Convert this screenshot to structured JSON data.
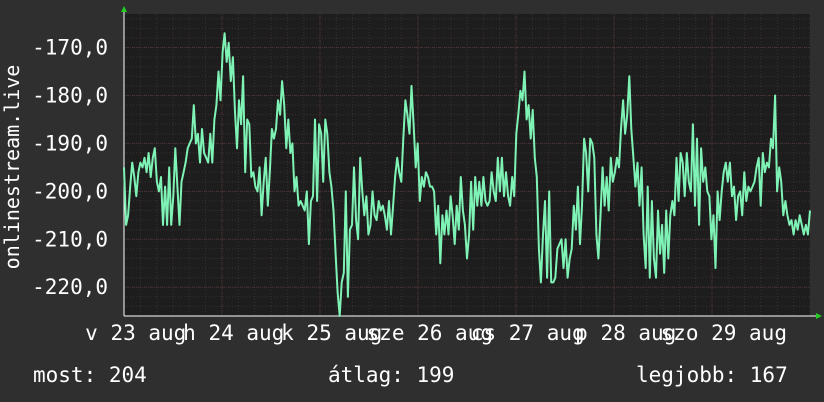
{
  "colors": {
    "background": "#2f2f2f",
    "plot_background": "#1d1d1d",
    "line": "#7ff3b5",
    "grid_major": "#4a3434",
    "grid_minor": "#3a3030",
    "axis_arrow": "#22cc22",
    "text": "#ffffff"
  },
  "stats": {
    "current": "most: 204",
    "average": "átlag: 199",
    "best": "legjobb: 167"
  },
  "chart_data": {
    "type": "line",
    "ylabel": "onlinestream.live",
    "ylim": [
      -226,
      -163
    ],
    "yticks": [
      -170,
      -180,
      -190,
      -200,
      -210,
      -220
    ],
    "ytick_labels": [
      "-170,0",
      "-180,0",
      "-190,0",
      "-200,0",
      "-210,0",
      "-220,0"
    ],
    "x_range": [
      0,
      7
    ],
    "x_ticks": [
      {
        "pos": 0.0,
        "label": "v 23 aug"
      },
      {
        "pos": 1.0,
        "label": "h 24 aug"
      },
      {
        "pos": 2.0,
        "label": "k 25 aug"
      },
      {
        "pos": 3.0,
        "label": "sze 26 aug"
      },
      {
        "pos": 4.0,
        "label": "cs 27 aug"
      },
      {
        "pos": 5.0,
        "label": "p 28 aug"
      },
      {
        "pos": 6.0,
        "label": "szo 29 aug"
      }
    ],
    "x_label_offset": 0.12,
    "series": [
      {
        "values": [
          -195,
          -207,
          -205,
          -199,
          -194,
          -197,
          -201,
          -196,
          -194,
          -195,
          -193,
          -196,
          -192,
          -197,
          -193,
          -191,
          -198,
          -200,
          -197,
          -207,
          -199,
          -207,
          -195,
          -207,
          -201,
          -191,
          -199,
          -207,
          -198,
          -196,
          -194,
          -191,
          -190,
          -189,
          -182,
          -190,
          -188,
          -194,
          -187,
          -192,
          -193,
          -194,
          -188,
          -194,
          -185,
          -182,
          -175,
          -181,
          -171,
          -167,
          -173,
          -169,
          -177,
          -172,
          -183,
          -191,
          -181,
          -186,
          -176,
          -196,
          -185,
          -186,
          -197,
          -196,
          -199,
          -200,
          -195,
          -205,
          -198,
          -193,
          -203,
          -196,
          -187,
          -189,
          -187,
          -181,
          -184,
          -177,
          -182,
          -191,
          -185,
          -192,
          -190,
          -200,
          -197,
          -203,
          -202,
          -203,
          -204,
          -200,
          -211,
          -202,
          -201,
          -185,
          -202,
          -186,
          -188,
          -198,
          -185,
          -188,
          -196,
          -199,
          -204,
          -213,
          -221,
          -226,
          -219,
          -217,
          -200,
          -222,
          -208,
          -207,
          -195,
          -206,
          -210,
          -193,
          -200,
          -205,
          -201,
          -209,
          -207,
          -200,
          -205,
          -206,
          -202,
          -204,
          -203,
          -205,
          -208,
          -202,
          -209,
          -203,
          -197,
          -193,
          -196,
          -198,
          -189,
          -181,
          -184,
          -188,
          -178,
          -186,
          -195,
          -190,
          -202,
          -197,
          -199,
          -196,
          -197,
          -199,
          -199,
          -200,
          -209,
          -203,
          -215,
          -205,
          -209,
          -204,
          -209,
          -201,
          -205,
          -211,
          -203,
          -208,
          -197,
          -204,
          -207,
          -214,
          -209,
          -198,
          -208,
          -197,
          -203,
          -198,
          -203,
          -197,
          -202,
          -203,
          -202,
          -196,
          -200,
          -202,
          -193,
          -200,
          -193,
          -201,
          -196,
          -201,
          -203,
          -197,
          -201,
          -188,
          -184,
          -179,
          -181,
          -175,
          -185,
          -182,
          -189,
          -183,
          -193,
          -197,
          -212,
          -219,
          -209,
          -202,
          -218,
          -200,
          -219,
          -219,
          -218,
          -212,
          -211,
          -210,
          -216,
          -210,
          -218,
          -214,
          -212,
          -203,
          -208,
          -199,
          -211,
          -203,
          -189,
          -192,
          -200,
          -189,
          -190,
          -193,
          -209,
          -214,
          -205,
          -195,
          -203,
          -197,
          -204,
          -193,
          -198,
          -196,
          -193,
          -195,
          -187,
          -181,
          -188,
          -184,
          -176,
          -187,
          -193,
          -199,
          -194,
          -203,
          -195,
          -209,
          -216,
          -199,
          -218,
          -202,
          -214,
          -218,
          -204,
          -213,
          -207,
          -217,
          -204,
          -214,
          -205,
          -202,
          -205,
          -193,
          -202,
          -192,
          -194,
          -201,
          -192,
          -198,
          -200,
          -186,
          -203,
          -189,
          -207,
          -191,
          -198,
          -195,
          -200,
          -201,
          -210,
          -205,
          -216,
          -200,
          -206,
          -200,
          -196,
          -194,
          -198,
          -194,
          -201,
          -199,
          -206,
          -201,
          -200,
          -205,
          -196,
          -202,
          -199,
          -200,
          -199,
          -198,
          -195,
          -193,
          -203,
          -192,
          -196,
          -194,
          -195,
          -189,
          -191,
          -180,
          -200,
          -195,
          -198,
          -205,
          -202,
          -205,
          -207,
          -206,
          -209,
          -206,
          -208,
          -205,
          -207,
          -209,
          -207,
          -209,
          -204
        ]
      }
    ]
  }
}
